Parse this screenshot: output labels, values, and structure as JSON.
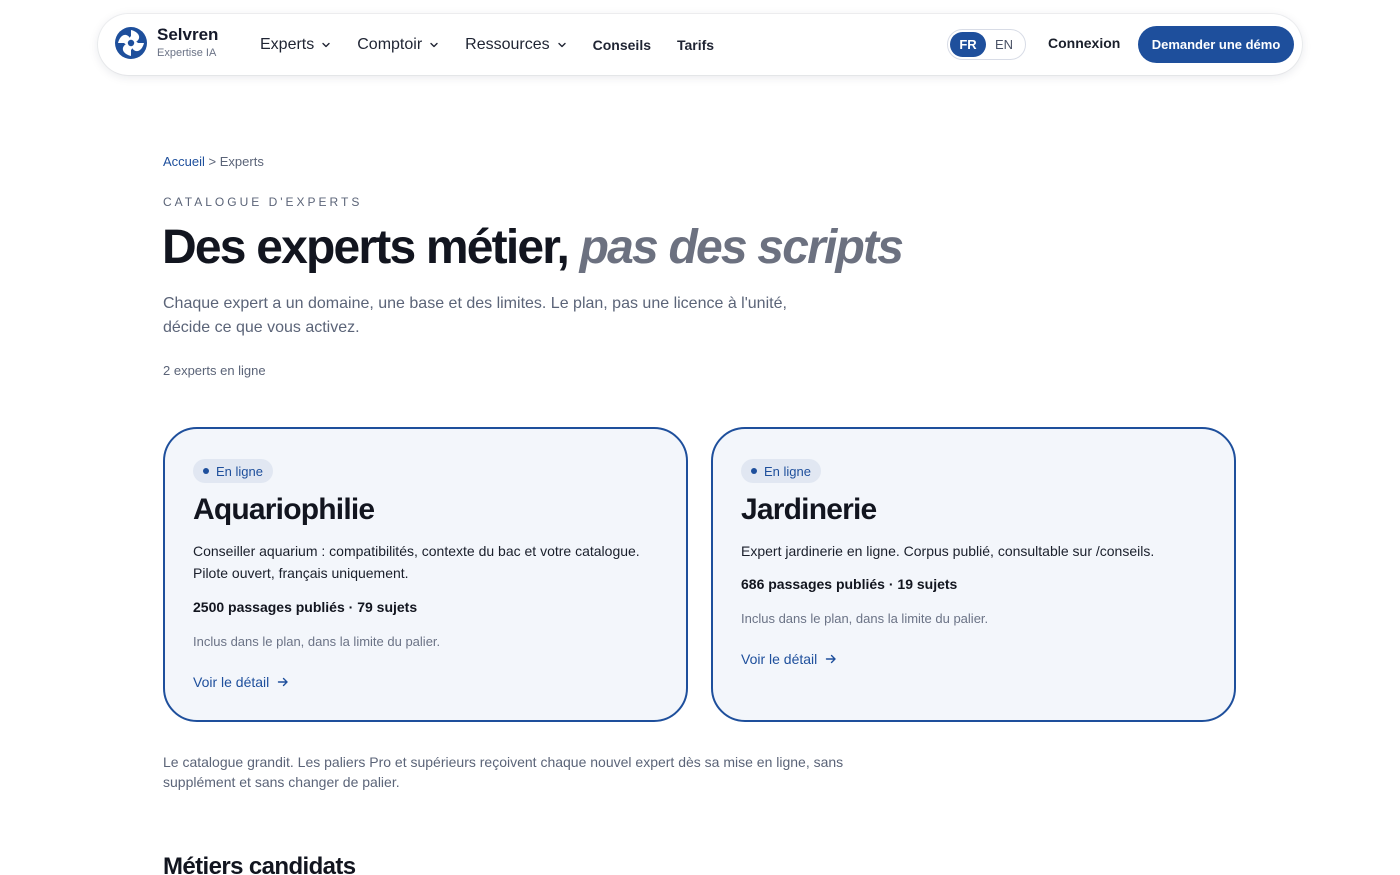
{
  "brand": {
    "name": "Selvren",
    "subtitle": "Expertise IA"
  },
  "nav": {
    "items": [
      {
        "label": "Experts",
        "dropdown": true
      },
      {
        "label": "Comptoir",
        "dropdown": true
      },
      {
        "label": "Ressources",
        "dropdown": true
      },
      {
        "label": "Conseils",
        "dropdown": false
      },
      {
        "label": "Tarifs",
        "dropdown": false
      }
    ],
    "lang": {
      "active": "FR",
      "other": "EN"
    },
    "login_label": "Connexion",
    "demo_label": "Demander une démo"
  },
  "breadcrumb": {
    "home": "Accueil",
    "separator": ">",
    "current": "Experts"
  },
  "hero": {
    "eyebrow": "CATALOGUE D'EXPERTS",
    "title_main": "Des experts métier,",
    "title_italic": "pas des scripts",
    "lead": "Chaque expert a un domaine, une base et des limites. Le plan, pas une licence à l'unité, décide ce que vous activez.",
    "online_count": "2 experts en ligne"
  },
  "cards": [
    {
      "status": "En ligne",
      "title": "Aquariophilie",
      "description": "Conseiller aquarium : compatibilités, contexte du bac et votre catalogue. Pilote ouvert, français uniquement.",
      "stats": "2500 passages publiés · 79 sujets",
      "note": "Inclus dans le plan, dans la limite du palier.",
      "link": "Voir le détail"
    },
    {
      "status": "En ligne",
      "title": "Jardinerie",
      "description": "Expert jardinerie en ligne. Corpus publié, consultable sur /conseils.",
      "stats": "686 passages publiés · 19 sujets",
      "note": "Inclus dans le plan, dans la limite du palier.",
      "link": "Voir le détail"
    }
  ],
  "footer_note": "Le catalogue grandit. Les paliers Pro et supérieurs reçoivent chaque nouvel expert dès sa mise en ligne, sans supplément et sans changer de palier.",
  "section2_title": "Métiers candidats",
  "colors": {
    "accent": "#1e4f9c",
    "card_bg": "#f3f6fb",
    "muted": "#5b6478"
  },
  "icons": {
    "logo": "swirl-logo-icon",
    "dropdown": "chevron-down-icon",
    "link": "arrow-right-icon"
  }
}
